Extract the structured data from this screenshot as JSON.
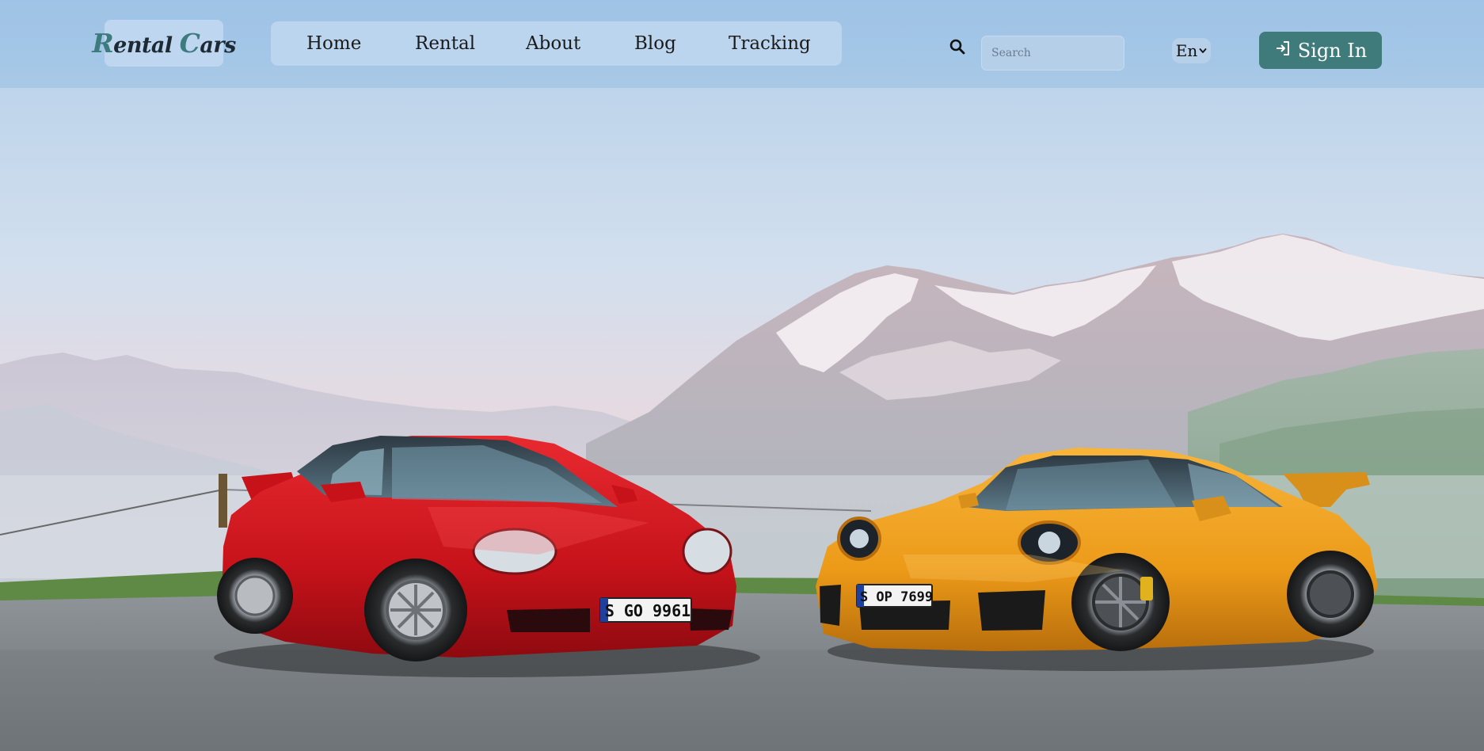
{
  "brand": {
    "logo_first_initial": "R",
    "logo_first_rest": "ental",
    "logo_second_initial": "C",
    "logo_second_rest": "ars"
  },
  "nav": {
    "items": [
      {
        "label": "Home"
      },
      {
        "label": "Rental"
      },
      {
        "label": "About"
      },
      {
        "label": "Blog"
      },
      {
        "label": "Tracking"
      }
    ]
  },
  "search": {
    "placeholder": "Search",
    "value": "",
    "icon": "search-icon"
  },
  "language": {
    "selected": "En",
    "icon": "chevron-down-icon"
  },
  "signin": {
    "label": "Sign In",
    "icon": "sign-in-icon"
  },
  "hero": {
    "car_left_plate": "S GO 9961",
    "car_right_plate": "S OP 7699"
  },
  "colors": {
    "header_bg": "#a3c6e7",
    "accent": "#3e7b7a",
    "car_left": "#d4141c",
    "car_right": "#f0a020"
  }
}
